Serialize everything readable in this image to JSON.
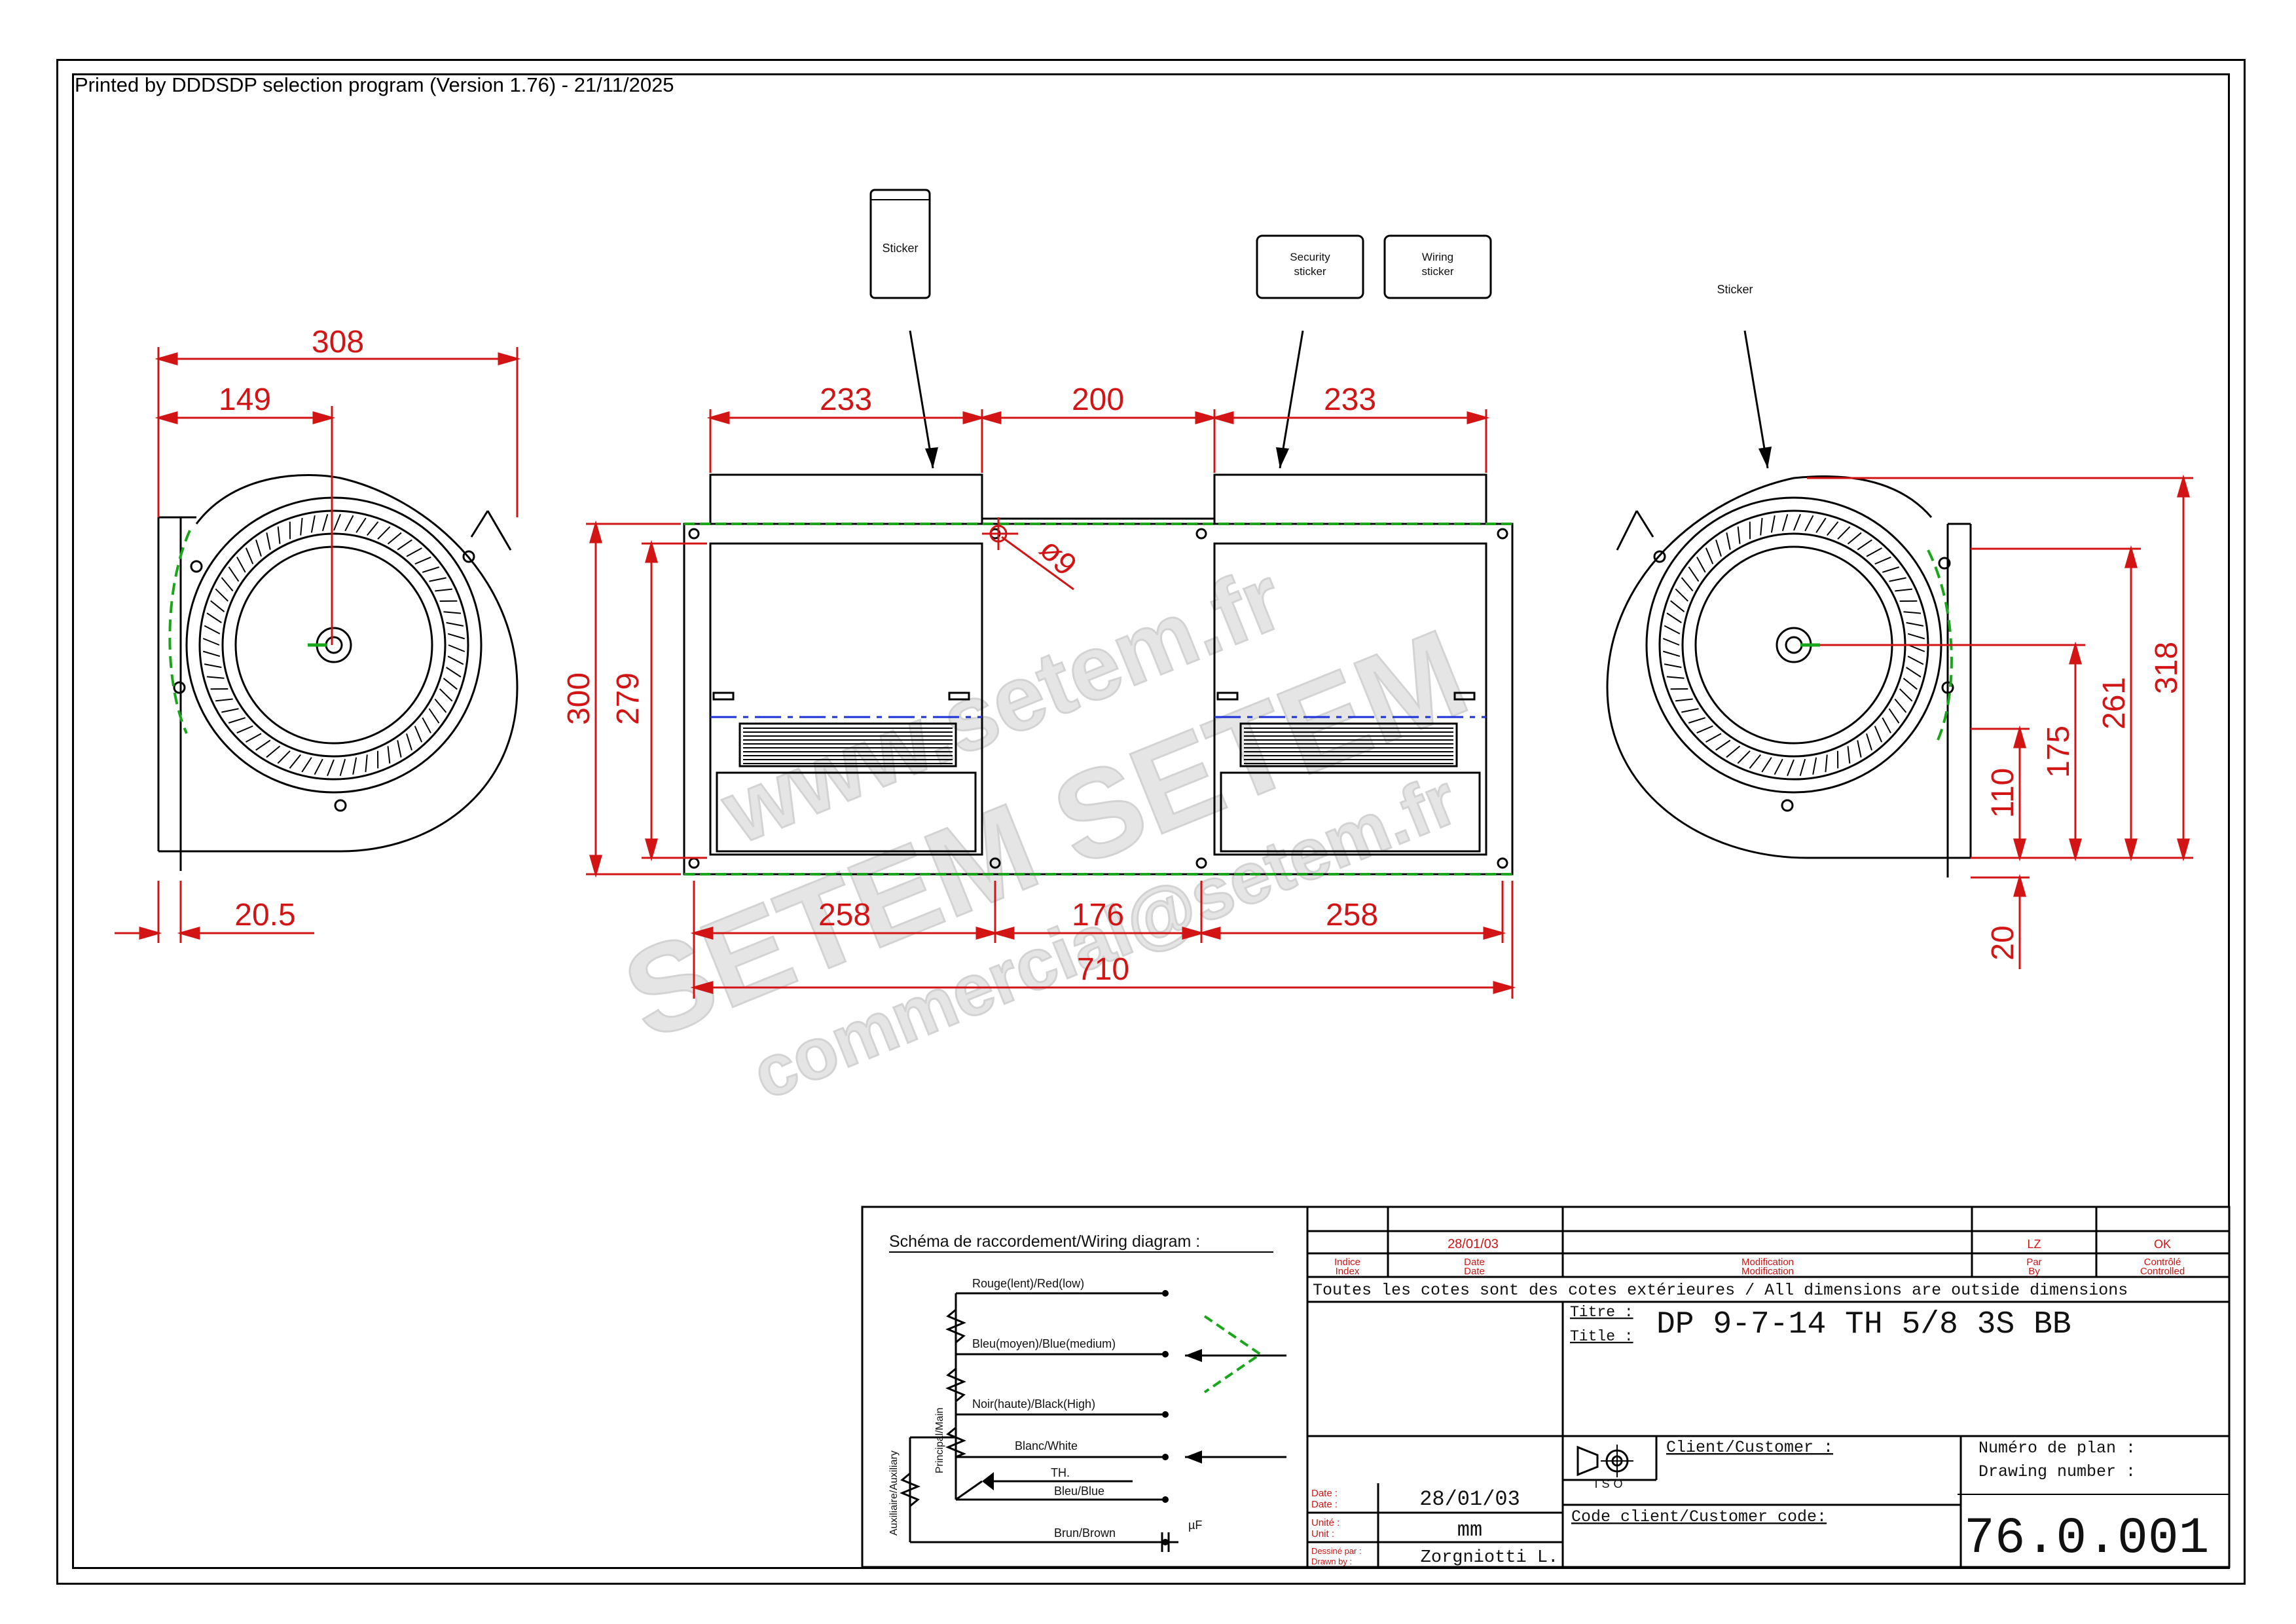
{
  "header": {
    "print_info": "Printed by DDDSDP selection program (Version 1.76) - 21/11/2025"
  },
  "stickers": {
    "top_left": "Sticker",
    "security_line1": "Security",
    "security_line2": "sticker",
    "wiring_line1": "Wiring",
    "wiring_line2": "sticker",
    "right": "Sticker"
  },
  "dimensions": {
    "left_width": "308",
    "left_center": "149",
    "left_offset": "20.5",
    "top_a": "233",
    "top_b": "200",
    "top_c": "233",
    "height_outer": "300",
    "height_inner": "279",
    "hole_dia": "ø9",
    "bottom_a": "258",
    "bottom_b": "176",
    "bottom_c": "258",
    "total_length": "710",
    "right_318": "318",
    "right_261": "261",
    "right_175": "175",
    "right_110": "110",
    "right_20": "20"
  },
  "watermark": {
    "line1": "www.setem.fr",
    "line2": "SETEM SETEM",
    "line3": "commercial@setem.fr"
  },
  "wiring": {
    "title": "Schéma de raccordement/Wiring diagram :",
    "red": "Rouge(lent)/Red(low)",
    "blue_medium": "Bleu(moyen)/Blue(medium)",
    "black": "Noir(haute)/Black(High)",
    "white": "Blanc/White",
    "th": "TH.",
    "blue": "Bleu/Blue",
    "brown": "Brun/Brown",
    "uf": "µF",
    "principal": "Principal/Main",
    "auxiliary": "Auxiliaire/Auxiliary"
  },
  "title_block": {
    "rev_date": "28/01/03",
    "rev_by": "LZ",
    "rev_ok": "OK",
    "index_fr": "Indice",
    "index_en": "Index",
    "date_fr": "Date",
    "date_en": "Date",
    "modif_fr": "Modification",
    "modif_en": "Modification",
    "by_fr": "Par",
    "by_en": "By",
    "ctrl_fr": "Contrôlé",
    "ctrl_en": "Controlled",
    "note": "Toutes les cotes sont des cotes extérieures / All dimensions are outside dimensions",
    "title_fr": "Titre :",
    "title_en": "Title :",
    "title_value": "DP 9-7-14 TH 5/8 3S BB",
    "iso": "ISO",
    "client": "Client/Customer :",
    "client_code": "Code client/Customer code:",
    "plan_fr": "Numéro de plan :",
    "plan_en": "Drawing number :",
    "plan_value": "76.0.001",
    "date_label_fr": "Date :",
    "date_label_en": "Date :",
    "date_value": "28/01/03",
    "unit_label_fr": "Unité :",
    "unit_label_en": "Unit :",
    "unit_value": "mm",
    "drawn_fr": "Dessiné par :",
    "drawn_en": "Drawn by :",
    "drawn_value": "Zorgniotti L."
  },
  "colors": {
    "dimension": "#d21414",
    "green_dashed": "#1aa61a",
    "blue_axis": "#1a2fd6",
    "line": "#000000"
  }
}
